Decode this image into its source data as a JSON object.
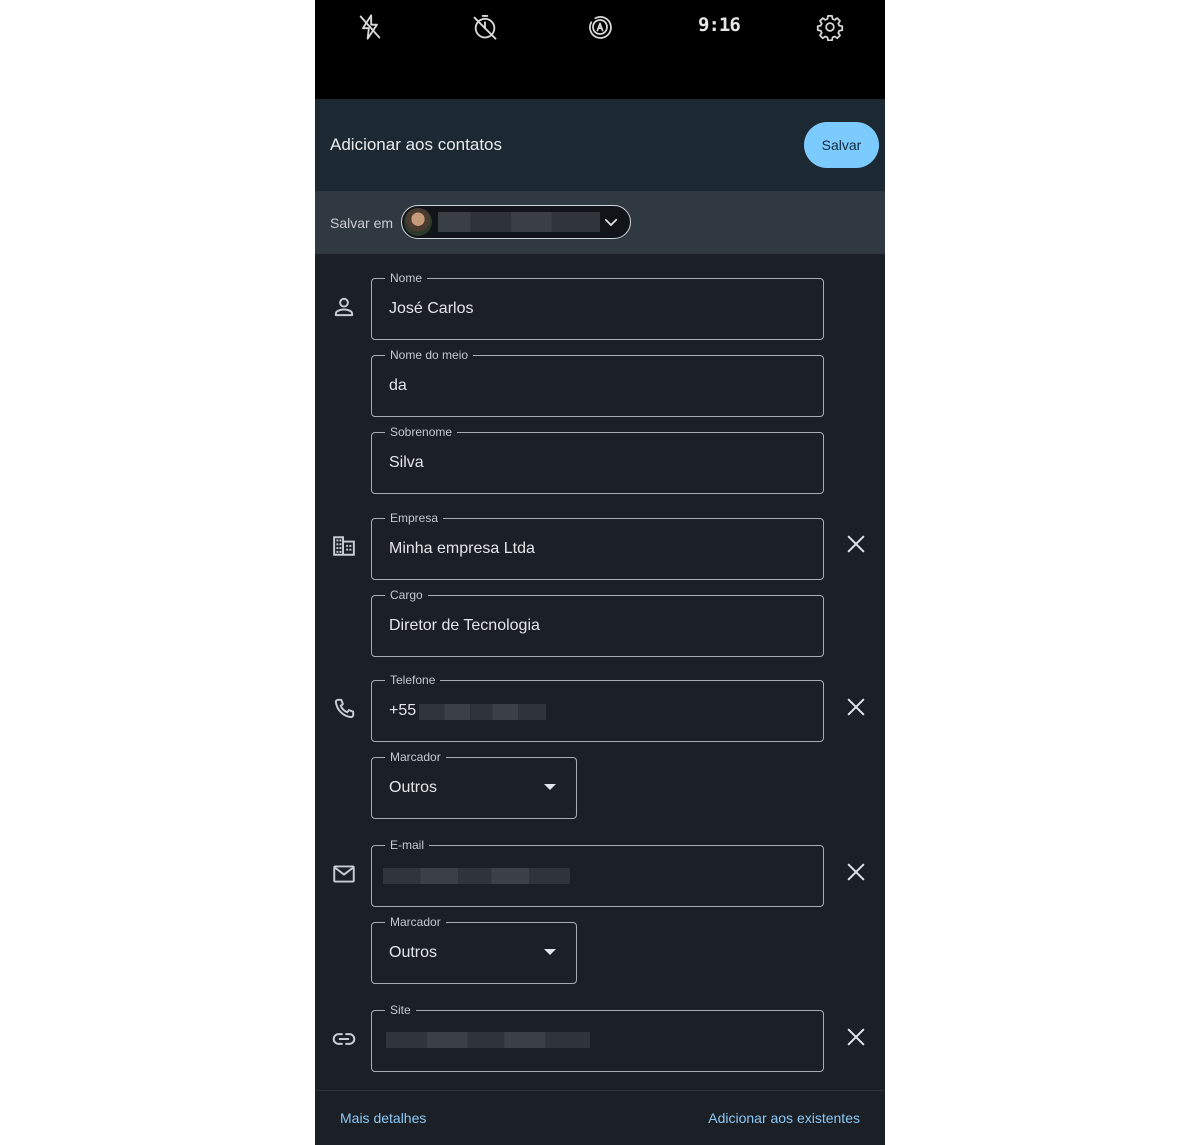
{
  "camera_bar": {
    "time": "9:16",
    "icons": [
      "flash-off-icon",
      "timer-off-icon",
      "auto-mode-icon",
      "settings-icon"
    ]
  },
  "header": {
    "title": "Adicionar aos contatos",
    "save_label": "Salvar"
  },
  "save_in": {
    "label": "Salvar em"
  },
  "form": {
    "name": {
      "label": "Nome",
      "value": "José Carlos"
    },
    "middle_name": {
      "label": "Nome do meio",
      "value": "da"
    },
    "surname": {
      "label": "Sobrenome",
      "value": "Silva"
    },
    "company": {
      "label": "Empresa",
      "value": "Minha empresa Ltda"
    },
    "title": {
      "label": "Cargo",
      "value": "Diretor de Tecnologia"
    },
    "phone": {
      "label": "Telefone",
      "value": "+55"
    },
    "phone_tag": {
      "label": "Marcador",
      "value": "Outros"
    },
    "email": {
      "label": "E-mail"
    },
    "email_tag": {
      "label": "Marcador",
      "value": "Outros"
    },
    "site": {
      "label": "Site"
    }
  },
  "footer": {
    "more_details": "Mais detalhes",
    "add_existing": "Adicionar aos existentes"
  },
  "colors": {
    "accent": "#7ccbff",
    "link": "#8cc8f5",
    "background": "#1b1f26",
    "header_bg": "#1c2932"
  }
}
